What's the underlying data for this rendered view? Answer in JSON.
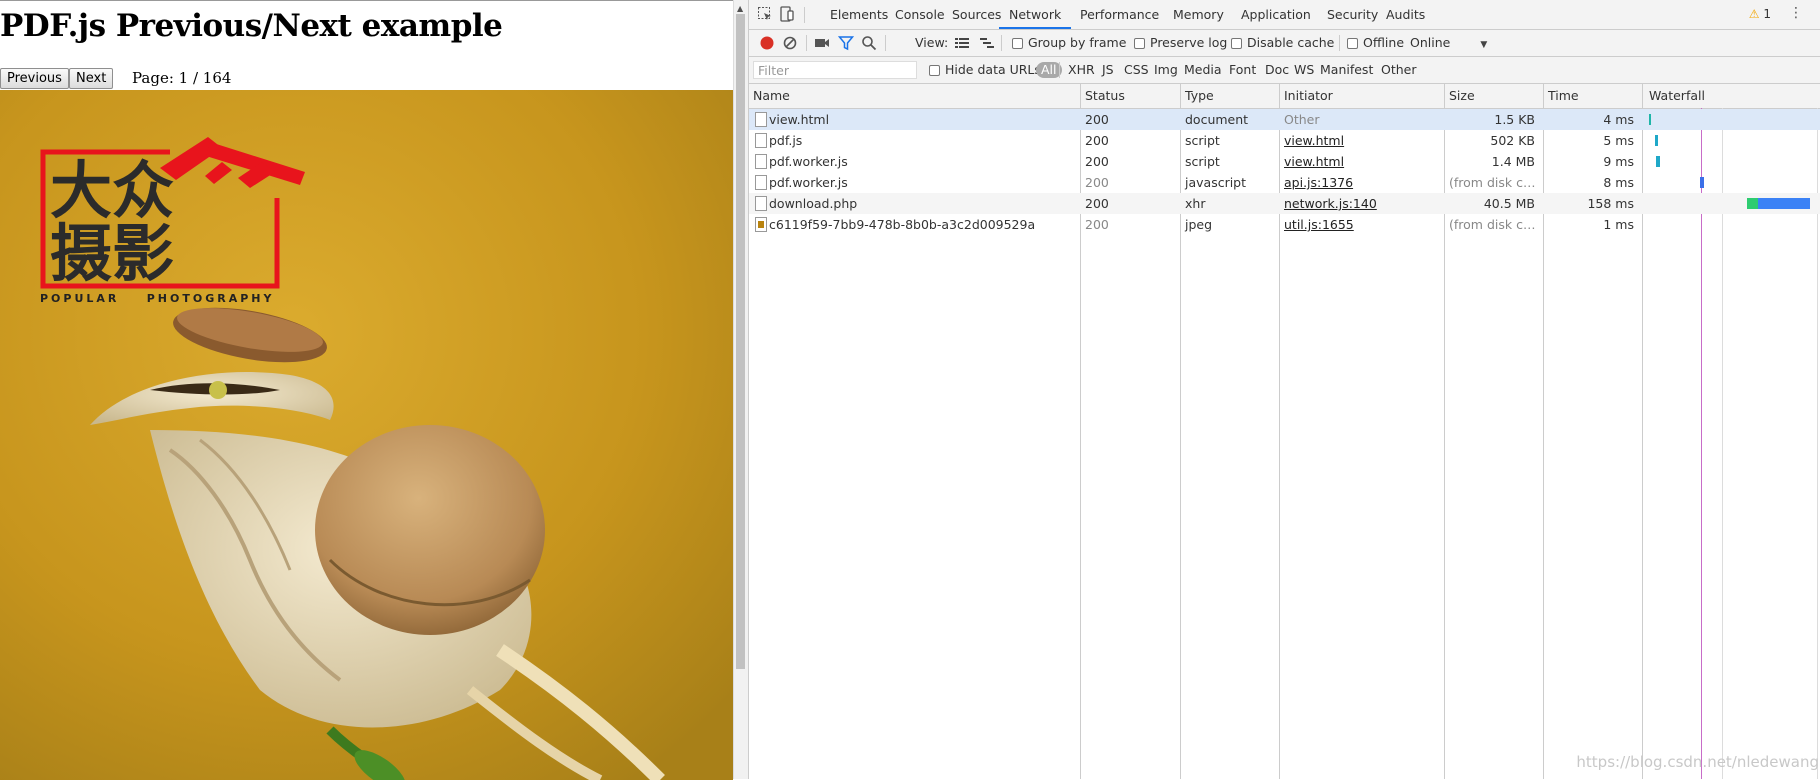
{
  "page": {
    "title": "PDF.js Previous/Next example",
    "prev_label": "Previous",
    "next_label": "Next",
    "page_info": "Page: 1 / 164",
    "brand_cn_top": "大众",
    "brand_cn_bottom": "摄影",
    "brand_en": "POPULAR    PHOTOGRAPHY"
  },
  "devtools": {
    "tabs": [
      "Elements",
      "Console",
      "Sources",
      "Network",
      "Performance",
      "Memory",
      "Application",
      "Security",
      "Audits"
    ],
    "active_tab": "Network",
    "warnings": "1",
    "toolbar": {
      "view_label": "View:",
      "group_by_frame": "Group by frame",
      "preserve_log": "Preserve log",
      "disable_cache": "Disable cache",
      "offline": "Offline",
      "throttle": "Online"
    },
    "filter": {
      "placeholder": "Filter",
      "hide_data_urls": "Hide data URLs",
      "types": [
        "All",
        "XHR",
        "JS",
        "CSS",
        "Img",
        "Media",
        "Font",
        "Doc",
        "WS",
        "Manifest",
        "Other"
      ]
    },
    "columns": [
      "Name",
      "Status",
      "Type",
      "Initiator",
      "Size",
      "Time",
      "Waterfall"
    ],
    "requests": [
      {
        "name": "view.html",
        "status": "200",
        "type": "document",
        "initiator": "Other",
        "size": "1.5 KB",
        "time": "4 ms"
      },
      {
        "name": "pdf.js",
        "status": "200",
        "type": "script",
        "initiator": "view.html",
        "size": "502 KB",
        "time": "5 ms"
      },
      {
        "name": "pdf.worker.js",
        "status": "200",
        "type": "script",
        "initiator": "view.html",
        "size": "1.4 MB",
        "time": "9 ms"
      },
      {
        "name": "pdf.worker.js",
        "status": "200",
        "type": "javascript",
        "initiator": "api.js:1376",
        "size": "(from disk cac...",
        "time": "8 ms"
      },
      {
        "name": "download.php",
        "status": "200",
        "type": "xhr",
        "initiator": "network.js:140",
        "size": "40.5 MB",
        "time": "158 ms"
      },
      {
        "name": "c6119f59-7bb9-478b-8b0b-a3c2d009529a",
        "status": "200",
        "type": "jpeg",
        "initiator": "util.js:1655",
        "size": "(from disk cac...",
        "time": "1 ms"
      }
    ],
    "watermark": "https://blog.csdn.net/nledewang",
    "colors": {
      "accent": "#1a73e8",
      "record": "#d93025",
      "waterfall_blue": "#3b82f6",
      "waterfall_green": "#2ecc71",
      "waterfall_teal": "#1fb5a8"
    }
  }
}
